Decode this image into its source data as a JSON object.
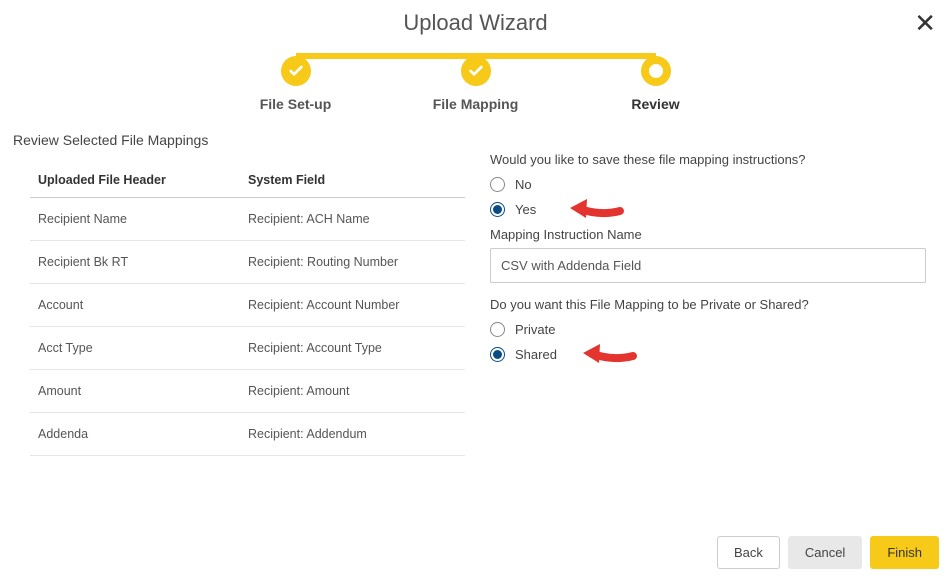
{
  "header": {
    "title": "Upload Wizard"
  },
  "stepper": {
    "steps": [
      {
        "label": "File Set-up",
        "state": "done"
      },
      {
        "label": "File Mapping",
        "state": "done"
      },
      {
        "label": "Review",
        "state": "current"
      }
    ]
  },
  "review": {
    "section_title": "Review Selected File Mappings",
    "columns": {
      "uploaded": "Uploaded File Header",
      "system": "System Field"
    },
    "rows": [
      {
        "uploaded": "Recipient Name",
        "system": "Recipient: ACH Name"
      },
      {
        "uploaded": "Recipient Bk RT",
        "system": "Recipient: Routing Number"
      },
      {
        "uploaded": "Account",
        "system": "Recipient: Account Number"
      },
      {
        "uploaded": "Acct Type",
        "system": "Recipient: Account Type"
      },
      {
        "uploaded": "Amount",
        "system": "Recipient: Amount"
      },
      {
        "uploaded": "Addenda",
        "system": "Recipient: Addendum"
      }
    ]
  },
  "form": {
    "save_question": "Would you like to save these file mapping instructions?",
    "no_label": "No",
    "yes_label": "Yes",
    "save_selected": "yes",
    "name_label": "Mapping Instruction Name",
    "name_value": "CSV with Addenda Field",
    "visibility_question": "Do you want this File Mapping to be Private or Shared?",
    "private_label": "Private",
    "shared_label": "Shared",
    "visibility_selected": "shared"
  },
  "footer": {
    "back": "Back",
    "cancel": "Cancel",
    "finish": "Finish"
  }
}
